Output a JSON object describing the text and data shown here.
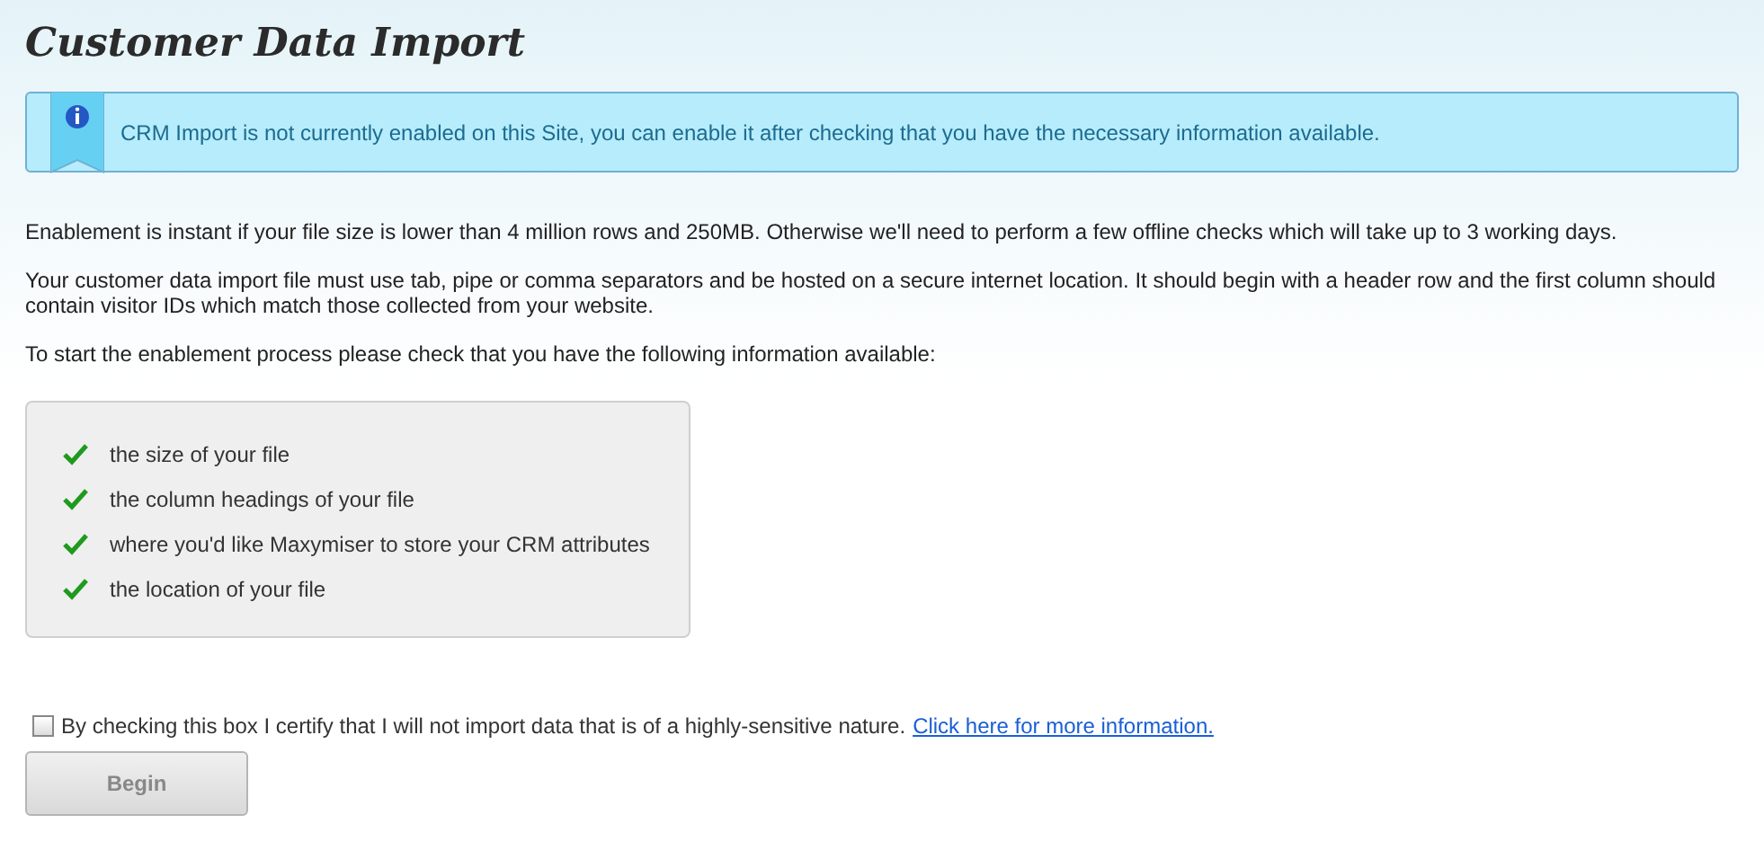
{
  "title": "Customer Data Import",
  "notice": "CRM Import is not currently enabled on this Site, you can enable it after checking that you have the necessary information available.",
  "paragraphs": [
    "Enablement is instant if your file size is lower than 4 million rows and 250MB. Otherwise we'll need to perform a few offline checks which will take up to 3 working days.",
    "Your customer data import file must use tab, pipe or comma separators and be hosted on a secure internet location. It should begin with a header row and the first column should contain visitor IDs which match those collected from your website.",
    "To start the enablement process please check that you have the following information available:"
  ],
  "checklist": [
    {
      "label": "the size of your file",
      "checked": true
    },
    {
      "label": "the column headings of your file",
      "checked": true
    },
    {
      "label": "where you'd like Maxymiser to store your CRM attributes",
      "checked": true
    },
    {
      "label": "the location of your file",
      "checked": true
    }
  ],
  "certify": {
    "label": "By checking this box I certify that I will not import data that is of a highly-sensitive nature.",
    "link": "Click here for more information.",
    "checked": false
  },
  "begin_button": {
    "label": "Begin",
    "disabled": true
  }
}
